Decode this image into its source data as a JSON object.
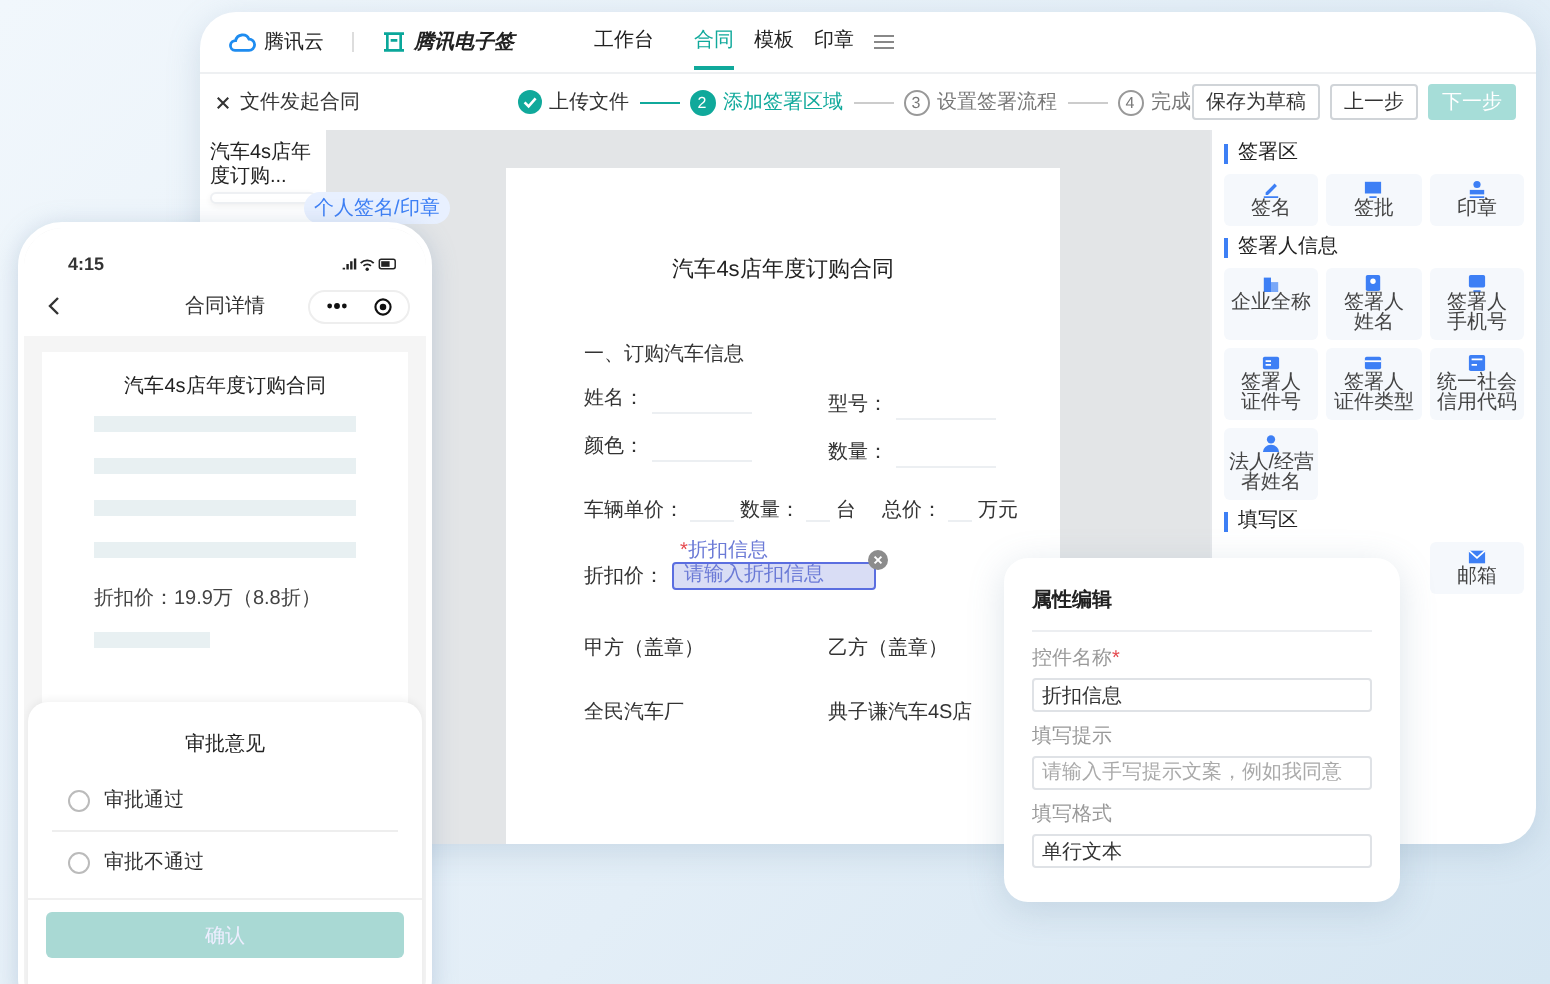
{
  "tablet": {
    "brand": "腾讯云",
    "product": "腾讯电子签",
    "nav": [
      {
        "label": "工作台",
        "selected": false
      },
      {
        "label": "合同",
        "selected": true
      },
      {
        "label": "模板",
        "selected": false
      },
      {
        "label": "印章",
        "selected": false
      }
    ],
    "task": "文件发起合同",
    "steps": [
      {
        "label": "上传文件",
        "done": true,
        "selected": false
      },
      {
        "num": "2",
        "label": "添加签署区域",
        "done": false,
        "selected": true
      },
      {
        "num": "3",
        "label": "设置签署流程",
        "done": false,
        "selected": false
      },
      {
        "num": "4",
        "label": "完成",
        "done": false,
        "selected": false
      }
    ],
    "actions": [
      {
        "label": "保存为草稿",
        "kind": "default",
        "disabled": false
      },
      {
        "label": "上一步",
        "kind": "default",
        "disabled": false
      },
      {
        "label": "下一步",
        "kind": "primary",
        "disabled": true
      }
    ],
    "thumbnail": {
      "title": "汽车4s店年度订购...",
      "tag": "个人签名/印章"
    },
    "document": {
      "title": "汽车4s店年度订购合同",
      "section": "一、订购汽车信息",
      "fields": [
        {
          "label": "姓名："
        },
        {
          "label": "型号："
        },
        {
          "label": "颜色："
        },
        {
          "label": "数量："
        }
      ],
      "price_row": [
        {
          "kind": "label",
          "text": "车辆单价："
        },
        {
          "kind": "blank"
        },
        {
          "kind": "label",
          "text": "数量："
        },
        {
          "kind": "blank"
        },
        {
          "kind": "label",
          "text": "台"
        },
        {
          "kind": "label",
          "text": "总价："
        },
        {
          "kind": "blank"
        },
        {
          "kind": "label",
          "text": "万元"
        }
      ],
      "discount": {
        "label": "折扣价：",
        "field_label": "折扣信息",
        "required_mark": "*",
        "placeholder": "请输入折扣信息",
        "selected": true
      },
      "parties": [
        {
          "role": "甲方（盖章）",
          "name": "全民汽车厂"
        },
        {
          "role": "乙方（盖章）",
          "name": "典子谦汽车4S店"
        }
      ]
    },
    "panel": {
      "sections": [
        {
          "title": "签署区",
          "kind": "sign",
          "items": [
            {
              "lines": [
                "签名"
              ]
            },
            {
              "lines": [
                "签批"
              ]
            },
            {
              "lines": [
                "印章"
              ]
            }
          ]
        },
        {
          "title": "签署人信息",
          "kind": "signer",
          "items": [
            {
              "lines": [
                "企业全称"
              ]
            },
            {
              "lines": [
                "签署人",
                "姓名"
              ]
            },
            {
              "lines": [
                "签署人",
                "手机号"
              ]
            },
            {
              "lines": [
                "签署人",
                "证件号"
              ]
            },
            {
              "lines": [
                "签署人",
                "证件类型"
              ]
            },
            {
              "lines": [
                "统一社会",
                "信用代码"
              ]
            },
            {
              "lines": [
                "法人/经营",
                "者姓名"
              ]
            }
          ]
        },
        {
          "title": "填写区",
          "kind": "fill",
          "items": [
            {
              "lines": [
                "邮箱"
              ]
            }
          ]
        }
      ]
    }
  },
  "property_editor": {
    "title": "属性编辑",
    "fields": [
      {
        "label": "控件名称",
        "required_mark": "*",
        "value": "折扣信息"
      },
      {
        "label": "填写提示",
        "placeholder": "请输入手写提示文案，例如我同意"
      },
      {
        "label": "填写格式",
        "value": "单行文本"
      }
    ]
  },
  "phone": {
    "time": "4:15",
    "title": "合同详情",
    "doc_title": "汽车4s店年度订购合同",
    "discount_text": "折扣价：19.9万（8.8折）",
    "sheet": {
      "title": "审批意见",
      "options": [
        {
          "label": "审批通过",
          "selected": false
        },
        {
          "label": "审批不通过",
          "selected": false
        }
      ],
      "confirm": {
        "label": "确认",
        "disabled": true
      }
    }
  }
}
